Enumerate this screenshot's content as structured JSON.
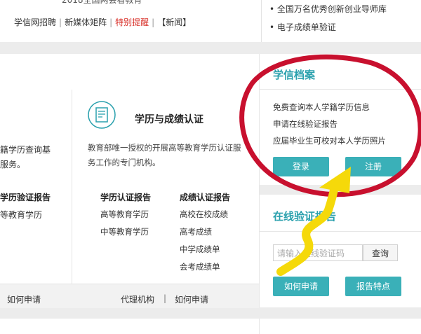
{
  "header": {
    "top_cut": "2018全国两会看教育",
    "links": [
      "学信网招聘",
      "新媒体矩阵",
      "特别提醒",
      "【新闻】"
    ],
    "link_sep": "|",
    "right_items": [
      "全国万名优秀创新创业导师库",
      "电子成绩单验证"
    ],
    "bullet": "•"
  },
  "left_card": {
    "text1": "籍学历查询基",
    "text2": "服务。",
    "report_title": "学历验证报告",
    "report_item": "等教育学历",
    "foot_link": "如何申请"
  },
  "middle_card": {
    "title": "学历与成绩认证",
    "description": "教育部唯一授权的开展高等教育学历认证服务工作的专门机构。",
    "col1": {
      "heading": "学历认证报告",
      "items": [
        "高等教育学历",
        "中等教育学历"
      ]
    },
    "col2": {
      "heading": "成绩认证报告",
      "items": [
        "高校在校成绩",
        "高考成绩",
        "中学成绩单",
        "会考成绩单"
      ]
    },
    "foot_links": [
      "代理机构",
      "如何申请"
    ],
    "foot_sep": "|"
  },
  "right_panel": {
    "archive_title": "学信档案",
    "archive_items": [
      "免费查询本人学籍学历信息",
      "申请在线验证报告",
      "应届毕业生可校对本人学历照片"
    ],
    "login_button": "登录",
    "register_button": "注册",
    "verify_title": "在线验证报告",
    "verify_placeholder": "请输入在线验证码",
    "query_button": "查询",
    "apply_button": "如何申请",
    "features_button": "报告特点"
  },
  "colors": {
    "accent": "#3ab0b8",
    "title_teal": "#2aa0ad",
    "alert_red": "#d9322b",
    "annotation_red": "#c8102e",
    "annotation_yellow": "#f5d90a"
  },
  "icons": [
    "certificate-icon"
  ]
}
